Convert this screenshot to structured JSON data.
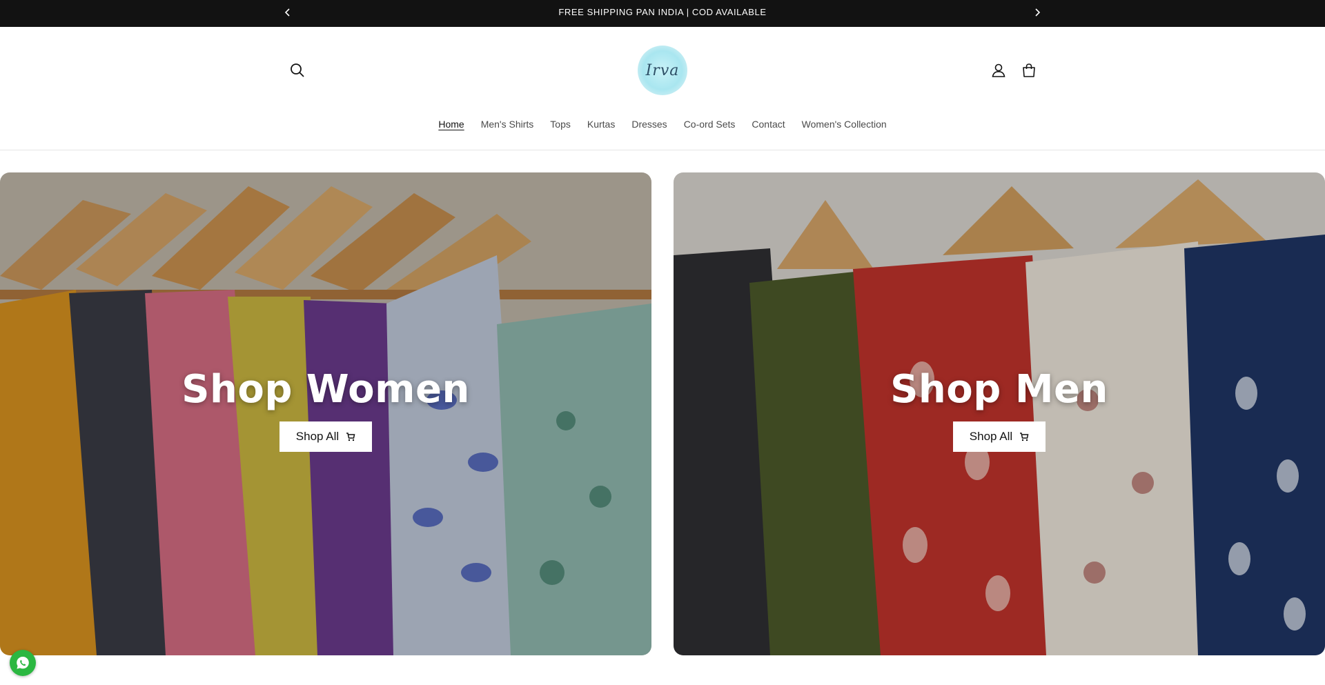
{
  "announcement": {
    "message": "FREE SHIPPING PAN INDIA | COD AVAILABLE",
    "prev_icon": "chevron-left-icon",
    "next_icon": "chevron-right-icon"
  },
  "header": {
    "logo_text": "Irva",
    "icons": [
      "search-icon",
      "account-icon",
      "cart-icon"
    ],
    "nav": [
      {
        "label": "Home",
        "active": true
      },
      {
        "label": "Men's Shirts"
      },
      {
        "label": "Tops"
      },
      {
        "label": "Kurtas"
      },
      {
        "label": "Dresses"
      },
      {
        "label": "Co-ord Sets"
      },
      {
        "label": "Contact"
      },
      {
        "label": "Women's Collection"
      }
    ]
  },
  "collage": [
    {
      "heading": "Shop Women",
      "button": "Shop All"
    },
    {
      "heading": "Shop Men",
      "button": "Shop All"
    }
  ],
  "floating": {
    "whatsapp_icon": "whatsapp-icon"
  },
  "colors": {
    "announcement_bg": "#121212",
    "whatsapp": "#2bb741",
    "logo_bg": "#a9e6f0"
  }
}
